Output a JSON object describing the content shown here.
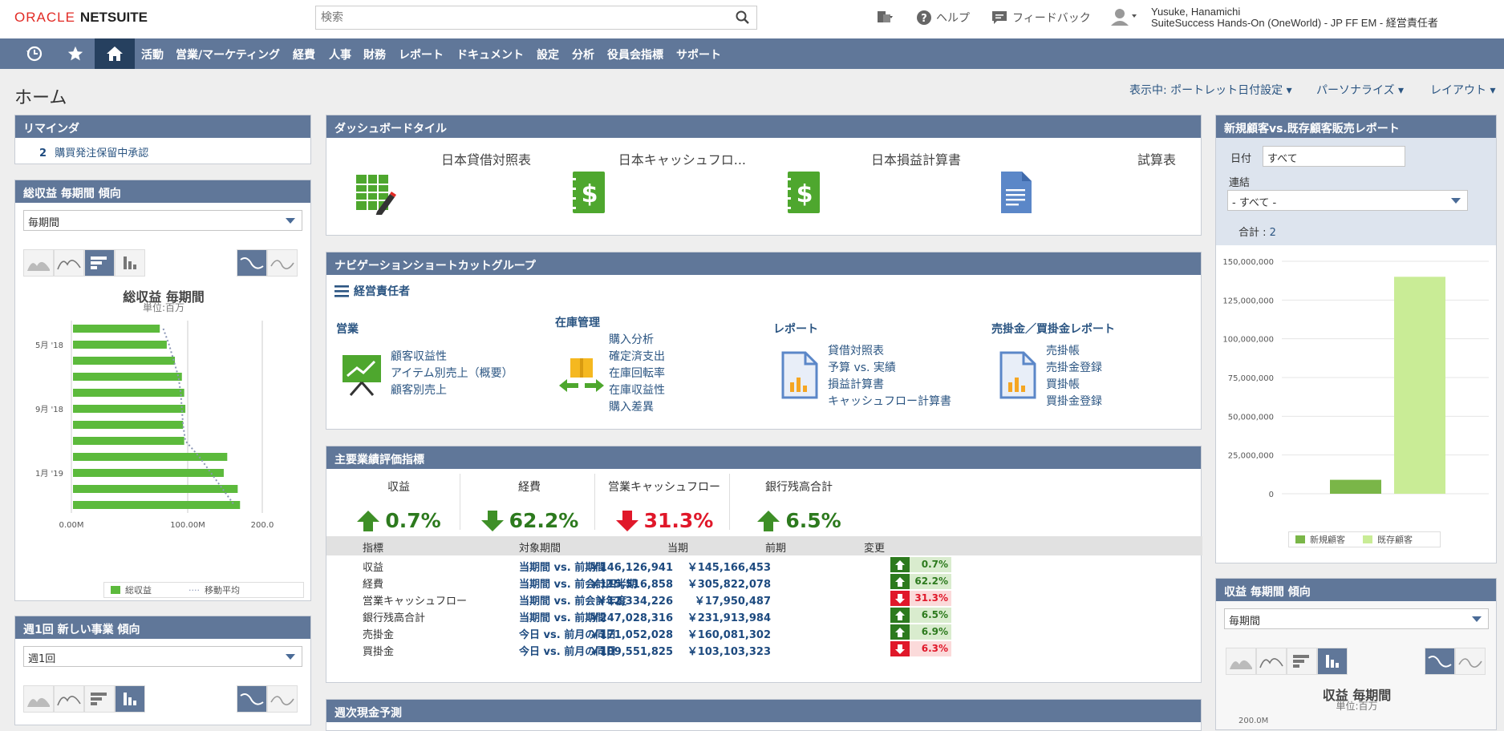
{
  "brand": {
    "oracle": "ORACLE",
    "netsuite": "NETSUITE"
  },
  "search": {
    "placeholder": "検索"
  },
  "topbar": {
    "help": "ヘルプ",
    "feedback": "フィードバック",
    "user_name": "Yusuke, Hanamichi",
    "user_role": "SuiteSuccess Hands-On (OneWorld) - JP FF EM - 経営責任者"
  },
  "nav": {
    "items": [
      "活動",
      "営業/マーケティング",
      "経費",
      "人事",
      "財務",
      "レポート",
      "ドキュメント",
      "設定",
      "分析",
      "役員会指標",
      "サポート"
    ]
  },
  "page": {
    "title": "ホーム",
    "view": "表示中: ポートレット日付設定",
    "personalize": "パーソナライズ",
    "layout": "レイアウト"
  },
  "reminders": {
    "title": "リマインダ",
    "count": "2",
    "text": "購買発注保留中承認"
  },
  "trend1": {
    "title": "総収益 毎期間 傾向",
    "select": "毎期間",
    "chart_title": "総収益 毎期間",
    "unit": "単位:百万",
    "legend_revenue": "総収益",
    "legend_ma": "移動平均"
  },
  "trend2": {
    "title": "週1回 新しい事業 傾向",
    "select": "週1回"
  },
  "tiles": {
    "title": "ダッシュボードタイル",
    "items": [
      {
        "label": "日本貸借対照表",
        "bg": "#fde0e2"
      },
      {
        "label": "日本キャッシュフロ...",
        "bg": "#dce5f0"
      },
      {
        "label": "日本損益計算書",
        "bg": "#dce5f0"
      },
      {
        "label": "試算表",
        "bg": "#fde6d5"
      }
    ]
  },
  "shortcuts": {
    "title": "ナビゲーションショートカットグループ",
    "group": "経営責任者",
    "sales": {
      "heading": "営業",
      "links": [
        "顧客収益性",
        "アイテム別売上（概要）",
        "顧客別売上"
      ]
    },
    "inventory": {
      "heading": "在庫管理",
      "links": [
        "購入分析",
        "確定済支出",
        "在庫回転率",
        "在庫収益性",
        "購入差異"
      ]
    },
    "reports": {
      "heading": "レポート",
      "links": [
        "貸借対照表",
        "予算 vs. 実績",
        "損益計算書",
        "キャッシュフロー計算書"
      ]
    },
    "arap": {
      "heading": "売掛金／買掛金レポート",
      "links": [
        "売掛帳",
        "売掛金登録",
        "買掛帳",
        "買掛金登録"
      ]
    }
  },
  "kpi": {
    "title": "主要業績評価指標",
    "summary": [
      {
        "label": "収益",
        "value": "0.7%",
        "dir": "up"
      },
      {
        "label": "経費",
        "value": "62.2%",
        "dir": "up"
      },
      {
        "label": "営業キャッシュフロー",
        "value": "31.3%",
        "dir": "down"
      },
      {
        "label": "銀行残高合計",
        "value": "6.5%",
        "dir": "up"
      }
    ],
    "headers": {
      "metric": "指標",
      "period": "対象期間",
      "current": "当期",
      "previous": "前期",
      "change": "変更"
    },
    "rows": [
      {
        "metric": "収益",
        "period": "当期間 vs. 前期間",
        "current": "￥146,126,941",
        "previous": "￥145,166,453",
        "change": "0.7%",
        "dir": "up"
      },
      {
        "metric": "経費",
        "period": "当期間 vs. 前会計四半期",
        "current": "￥115,516,858",
        "previous": "￥305,822,078",
        "change": "62.2%",
        "dir": "up"
      },
      {
        "metric": "営業キャッシュフロー",
        "period": "当期間 vs. 前会計年度",
        "current": "￥12,334,226",
        "previous": "￥17,950,487",
        "change": "31.3%",
        "dir": "down"
      },
      {
        "metric": "銀行残高合計",
        "period": "当期間 vs. 前期間",
        "current": "￥247,028,316",
        "previous": "￥231,913,984",
        "change": "6.5%",
        "dir": "up"
      },
      {
        "metric": "売掛金",
        "period": "今日 vs. 前月の同日",
        "current": "￥171,052,028",
        "previous": "￥160,081,302",
        "change": "6.9%",
        "dir": "up"
      },
      {
        "metric": "買掛金",
        "period": "今日 vs. 前月の同日",
        "current": "￥109,551,825",
        "previous": "￥103,103,323",
        "change": "6.3%",
        "dir": "down"
      }
    ]
  },
  "weekly_cash": {
    "title": "週次現金予測"
  },
  "customer_report": {
    "title": "新規顧客vs.既存顧客販売レポート",
    "date_label": "日付",
    "date_value": "すべて",
    "consol_label": "連結",
    "consol_value": "- すべて -",
    "total_label": "合計 :",
    "total_value": "2",
    "legend_new": "新規顧客",
    "legend_existing": "既存顧客"
  },
  "trend3": {
    "title": "収益 毎期間 傾向",
    "select": "毎期間",
    "chart_title": "収益 毎期間",
    "unit": "単位:百万",
    "yfirst": "200.0M"
  },
  "chart_data": [
    {
      "type": "bar",
      "orientation": "horizontal",
      "title": "総収益 毎期間",
      "subtitle": "単位:百万",
      "categories": [
        "",
        "5月 '18",
        "",
        "",
        "",
        "9月 '18",
        "",
        "",
        "",
        "1月 '19",
        "",
        ""
      ],
      "series": [
        {
          "name": "総収益",
          "values": [
            76,
            82,
            89,
            95,
            97,
            98,
            96,
            97,
            134,
            131,
            143,
            145
          ]
        },
        {
          "name": "移動平均",
          "values": [
            79,
            84,
            88,
            92,
            94,
            95,
            96,
            98,
            110,
            120,
            130,
            140
          ]
        }
      ],
      "xticks": [
        "0.00M",
        "100.00M",
        "200.0"
      ],
      "xlim": [
        0,
        200
      ]
    },
    {
      "type": "bar",
      "title": "新規顧客vs.既存顧客販売レポート",
      "categories": [
        "新規顧客",
        "既存顧客"
      ],
      "values": [
        9000000,
        140000000
      ],
      "yticks": [
        "150,000,000",
        "125,000,000",
        "100,000,000",
        "75,000,000",
        "50,000,000",
        "25,000,000",
        "0"
      ],
      "ylim": [
        0,
        150000000
      ]
    }
  ]
}
